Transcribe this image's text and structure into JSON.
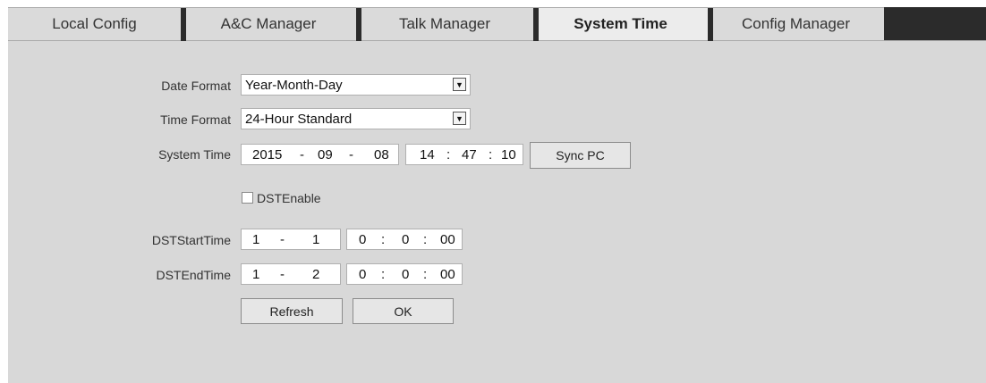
{
  "tabs": [
    {
      "label": "Local Config"
    },
    {
      "label": "A&C Manager"
    },
    {
      "label": "Talk Manager"
    },
    {
      "label": "System Time"
    },
    {
      "label": "Config Manager"
    }
  ],
  "form": {
    "date_format": {
      "label": "Date Format",
      "value": "Year-Month-Day"
    },
    "time_format": {
      "label": "Time Format",
      "value": "24-Hour Standard"
    },
    "system_time": {
      "label": "System Time",
      "year": "2015",
      "month": "09",
      "day": "08",
      "hour": "14",
      "minute": "47",
      "second": "10",
      "sep_date": "-",
      "sep_time": ":"
    },
    "sync_pc_label": "Sync PC",
    "dst_enable": {
      "label": "DSTEnable",
      "checked": false
    },
    "dst_start": {
      "label": "DSTStartTime",
      "month": "1",
      "day": "1",
      "hour": "0",
      "minute": "0",
      "second": "00"
    },
    "dst_end": {
      "label": "DSTEndTime",
      "month": "1",
      "day": "2",
      "hour": "0",
      "minute": "0",
      "second": "00"
    },
    "refresh_label": "Refresh",
    "ok_label": "OK"
  },
  "colors": {
    "panel_bg": "#d8d8d8",
    "active_tab_bg": "#ececec",
    "tab_divider": "#2b2b2b"
  },
  "icons": {
    "dropdown": "chevron-down-icon"
  }
}
